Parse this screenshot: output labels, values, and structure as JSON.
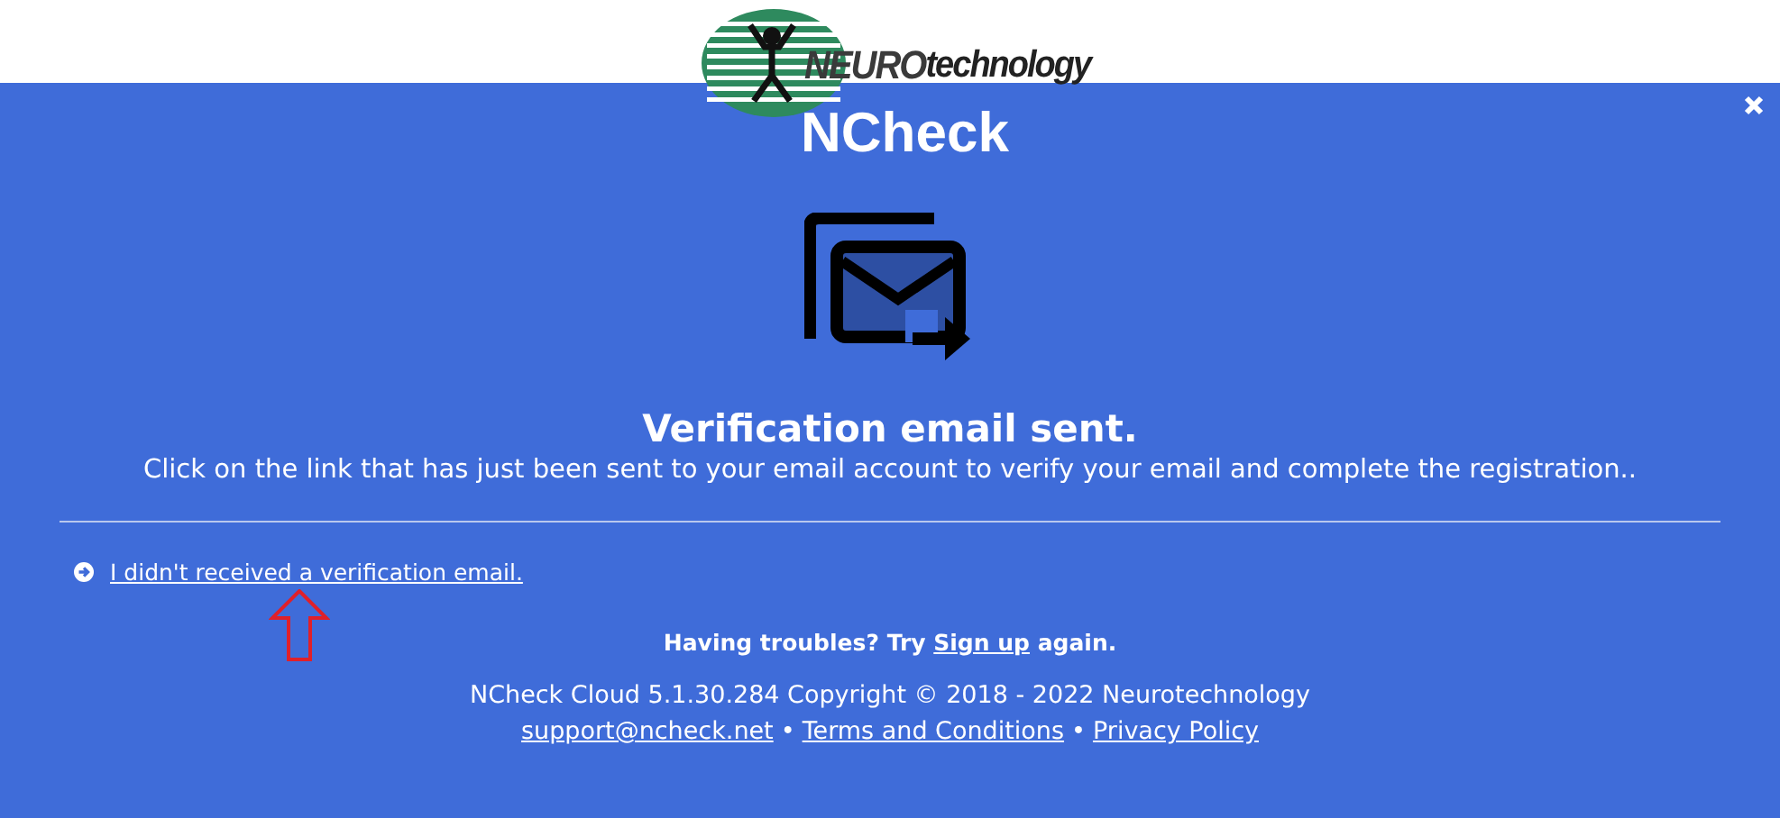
{
  "logo": {
    "brand_bold": "NEURO",
    "brand_rest": "technology"
  },
  "app_name": "NCheck",
  "heading": "Verification email sent.",
  "message": "Click on the link that has just been sent to your email account to verify your email and complete the registration..",
  "resend_link": "I didn't received a verification email.",
  "troubles": {
    "before": "Having troubles? Try",
    "link": "Sign up",
    "after": "again."
  },
  "copyright": "NCheck Cloud 5.1.30.284 Copyright © 2018 - 2022 Neurotechnology",
  "footer_links": [
    {
      "label": "support@ncheck.net"
    },
    {
      "label": "Terms and Conditions"
    },
    {
      "label": "Privacy Policy"
    }
  ],
  "separator": "•"
}
